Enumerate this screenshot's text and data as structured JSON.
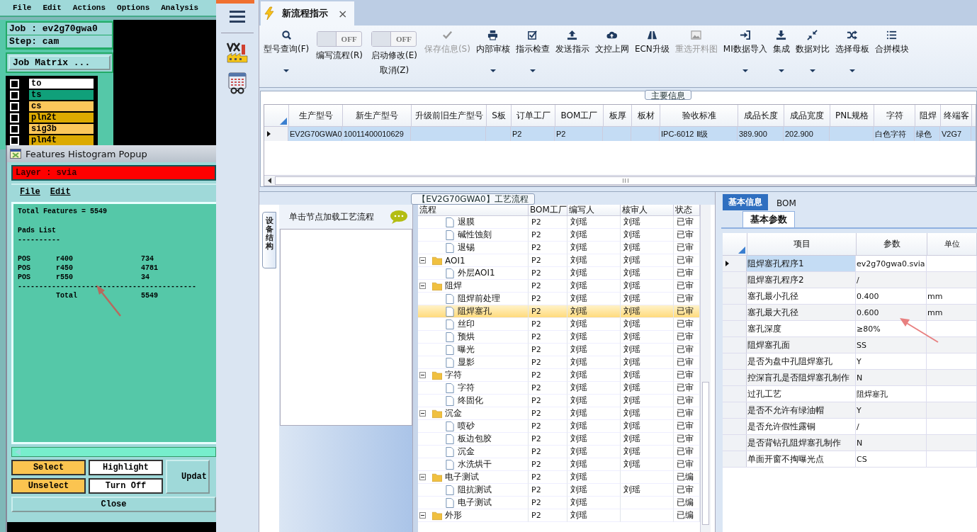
{
  "cam_window": {
    "menu": [
      "File",
      "Edit",
      "Actions",
      "Options",
      "Analysis"
    ],
    "job": "Job : ev2g70gwa0",
    "step": "Step: cam",
    "job_matrix_button": "Job Matrix ...",
    "layers": [
      {
        "name": "to",
        "checked": false,
        "color": "#ffffff"
      },
      {
        "name": "ts",
        "checked": false,
        "color": "#10a07a"
      },
      {
        "name": "cs",
        "checked": false,
        "color": "#fbc75a"
      },
      {
        "name": "pln2t",
        "checked": false,
        "color": "#dcaa00"
      },
      {
        "name": "sig3b",
        "checked": false,
        "color": "#fbc75a"
      },
      {
        "name": "pln4t",
        "checked": false,
        "color": "#dcaa00"
      }
    ]
  },
  "histogram_popup": {
    "title": "Features Histogram Popup",
    "layer": "Layer :  svia",
    "menu": [
      "File",
      "Edit"
    ],
    "blocks": [
      [
        "Total Features = 5549"
      ],
      [
        "Pads List",
        "----------"
      ],
      [
        "POS      r400                734",
        "POS      r450                4781",
        "POS      r550                34",
        "------------------------------------------",
        "         Total               5549"
      ]
    ],
    "buttons": [
      {
        "label": "Select",
        "kind": "action"
      },
      {
        "label": "Highlight",
        "kind": "toggle"
      },
      {
        "label": "Unselect",
        "kind": "action"
      },
      {
        "label": "Turn Off",
        "kind": "toggle"
      }
    ],
    "update_button": "Updat",
    "close_button": "Close"
  },
  "app_tab": {
    "title": "新流程指示",
    "close": "×",
    "selected": true
  },
  "toolbar": [
    {
      "kind": "button",
      "label": "型号查询(F)",
      "dropdown": true,
      "disabled": false
    },
    {
      "kind": "toggle",
      "label": "编写流程(R)",
      "state_text": "OFF",
      "on": false
    },
    {
      "kind": "toggle",
      "label": "启动修改(E)",
      "sublabel": "取消(Z)",
      "state_text": "OFF",
      "on": false
    },
    {
      "kind": "button",
      "label": "保存信息(S)",
      "dropdown": false,
      "disabled": true
    },
    {
      "kind": "button",
      "label": "内部审核",
      "dropdown": true,
      "disabled": false
    },
    {
      "kind": "button",
      "label": "指示检查",
      "dropdown": true,
      "disabled": false
    },
    {
      "kind": "button",
      "label": "发送指示",
      "dropdown": false,
      "disabled": false
    },
    {
      "kind": "button",
      "label": "文控上网",
      "dropdown": false,
      "disabled": false
    },
    {
      "kind": "button",
      "label": "ECN升级",
      "dropdown": false,
      "disabled": false
    },
    {
      "kind": "button",
      "label": "重选开料图",
      "dropdown": false,
      "disabled": true
    },
    {
      "kind": "button",
      "label": "MI数据导入",
      "dropdown": true,
      "disabled": false
    },
    {
      "kind": "button",
      "label": "集成",
      "dropdown": true,
      "disabled": false
    },
    {
      "kind": "button",
      "label": "数据对比",
      "dropdown": true,
      "disabled": false
    },
    {
      "kind": "button",
      "label": "选择母板",
      "dropdown": true,
      "disabled": false
    },
    {
      "kind": "button",
      "label": "合拼模块",
      "dropdown": false,
      "disabled": false
    }
  ],
  "main_info": {
    "title": "主要信息",
    "columns": [
      "生产型号",
      "新生产型号",
      "升级前旧生产型号",
      "S板",
      "订单工厂",
      "BOM工厂",
      "板厚",
      "板材",
      "验收标准",
      "成品长度",
      "成品宽度",
      "PNL规格",
      "字符",
      "阻焊",
      "终端客"
    ],
    "rows": [
      {
        "selected": true,
        "cells": [
          "EV2G70GWA0",
          "10011400010629",
          null,
          null,
          "P2",
          "P2",
          null,
          null,
          "IPC-6012 Ⅱ级",
          "389.900",
          "202.900",
          null,
          "白色字符",
          "绿色",
          "V2G7"
        ]
      }
    ]
  },
  "process_panel": {
    "title": "【EV2G70GWA0】工艺流程",
    "side_tab": "设备结构",
    "hint": "单击节点加载工艺流程",
    "columns": [
      "流程",
      "BOM工厂",
      "编写人",
      "核审人",
      "状态"
    ],
    "continued": [
      {
        "name": "退膜",
        "bom": "P2",
        "writer": "刘瑶",
        "reviewer": "刘瑶",
        "status": "已审",
        "selected": false
      },
      {
        "name": "碱性蚀刻",
        "bom": "P2",
        "writer": "刘瑶",
        "reviewer": "刘瑶",
        "status": "已审",
        "selected": false
      },
      {
        "name": "退锡",
        "bom": "P2",
        "writer": "刘瑶",
        "reviewer": "刘瑶",
        "status": "已审",
        "selected": false
      }
    ],
    "nodes": [
      {
        "name": "AOI1",
        "bom": "P2",
        "writer": "刘瑶",
        "reviewer": "刘瑶",
        "status": "已审",
        "selected": false,
        "expanded": true,
        "children": [
          {
            "name": "外层AOI1",
            "bom": "P2",
            "writer": "刘瑶",
            "reviewer": "刘瑶",
            "status": "已审",
            "selected": false
          }
        ]
      },
      {
        "name": "阻焊",
        "bom": "P2",
        "writer": "刘瑶",
        "reviewer": "刘瑶",
        "status": "已审",
        "selected": false,
        "expanded": true,
        "children": [
          {
            "name": "阻焊前处理",
            "bom": "P2",
            "writer": "刘瑶",
            "reviewer": "刘瑶",
            "status": "已审",
            "selected": false
          },
          {
            "name": "阻焊塞孔",
            "bom": "P2",
            "writer": "刘瑶",
            "reviewer": "刘瑶",
            "status": "已审",
            "selected": true
          },
          {
            "name": "丝印",
            "bom": "P2",
            "writer": "刘瑶",
            "reviewer": "刘瑶",
            "status": "已审",
            "selected": false
          },
          {
            "name": "预烘",
            "bom": "P2",
            "writer": "刘瑶",
            "reviewer": "刘瑶",
            "status": "已审",
            "selected": false
          },
          {
            "name": "曝光",
            "bom": "P2",
            "writer": "刘瑶",
            "reviewer": "刘瑶",
            "status": "已审",
            "selected": false
          },
          {
            "name": "显影",
            "bom": "P2",
            "writer": "刘瑶",
            "reviewer": "刘瑶",
            "status": "已审",
            "selected": false
          }
        ]
      },
      {
        "name": "字符",
        "bom": "P2",
        "writer": "刘瑶",
        "reviewer": "刘瑶",
        "status": "已审",
        "selected": false,
        "expanded": true,
        "children": [
          {
            "name": "字符",
            "bom": "P2",
            "writer": "刘瑶",
            "reviewer": "刘瑶",
            "status": "已审",
            "selected": false
          },
          {
            "name": "终固化",
            "bom": "P2",
            "writer": "刘瑶",
            "reviewer": "刘瑶",
            "status": "已审",
            "selected": false
          }
        ]
      },
      {
        "name": "沉金",
        "bom": "P2",
        "writer": "刘瑶",
        "reviewer": "刘瑶",
        "status": "已审",
        "selected": false,
        "expanded": true,
        "children": [
          {
            "name": "喷砂",
            "bom": "P2",
            "writer": "刘瑶",
            "reviewer": "刘瑶",
            "status": "已审",
            "selected": false
          },
          {
            "name": "板边包胶",
            "bom": "P2",
            "writer": "刘瑶",
            "reviewer": "刘瑶",
            "status": "已审",
            "selected": false
          },
          {
            "name": "沉金",
            "bom": "P2",
            "writer": "刘瑶",
            "reviewer": "刘瑶",
            "status": "已审",
            "selected": false
          },
          {
            "name": "水洗烘干",
            "bom": "P2",
            "writer": "刘瑶",
            "reviewer": "刘瑶",
            "status": "已审",
            "selected": false
          }
        ]
      },
      {
        "name": "电子测试",
        "bom": "P2",
        "writer": "刘瑶",
        "status": "已编",
        "selected": false,
        "expanded": true,
        "children": [
          {
            "name": "阻抗测试",
            "bom": "P2",
            "writer": "刘瑶",
            "reviewer": "刘瑶",
            "status": "已审",
            "selected": false
          },
          {
            "name": "电子测试",
            "bom": "P2",
            "writer": "刘瑶",
            "status": "已编",
            "selected": false
          }
        ]
      },
      {
        "name": "外形",
        "bom": "P2",
        "writer": "刘瑶",
        "status": "已编",
        "selected": false,
        "expanded": true
      }
    ]
  },
  "detail_panel": {
    "tabs": [
      {
        "label": "基本信息",
        "selected": true
      },
      {
        "label": "BOM",
        "selected": false
      }
    ],
    "subtab": "基本参数",
    "columns": [
      "项目",
      "参数",
      "单位"
    ],
    "rows": [
      {
        "item": "阻焊塞孔程序1",
        "value": "ev2g70gwa0.svia",
        "selected": true
      },
      {
        "item": "阻焊塞孔程序2",
        "value": "/",
        "selected": false
      },
      {
        "item": "塞孔最小孔径",
        "value": "0.400",
        "unit": "mm",
        "selected": false
      },
      {
        "item": "塞孔最大孔径",
        "value": "0.600",
        "unit": "mm",
        "selected": false
      },
      {
        "item": "塞孔深度",
        "value": "≥80%",
        "selected": false
      },
      {
        "item": "阻焊塞孔面",
        "value": "SS",
        "selected": false
      },
      {
        "item": "是否为盘中孔阻焊塞孔",
        "value": "Y",
        "selected": false
      },
      {
        "item": "控深盲孔是否阻焊塞孔制作",
        "value": "N",
        "selected": false
      },
      {
        "item": "过孔工艺",
        "value": "阻焊塞孔",
        "selected": false
      },
      {
        "item": "是否不允许有绿油帽",
        "value": "Y",
        "selected": false
      },
      {
        "item": "是否允许假性露铜",
        "value": "/",
        "selected": false
      },
      {
        "item": "是否背钻孔阻焊塞孔制作",
        "value": "N",
        "selected": false
      },
      {
        "item": "单面开窗不掏曝光点",
        "value": "CS",
        "selected": false
      }
    ]
  }
}
